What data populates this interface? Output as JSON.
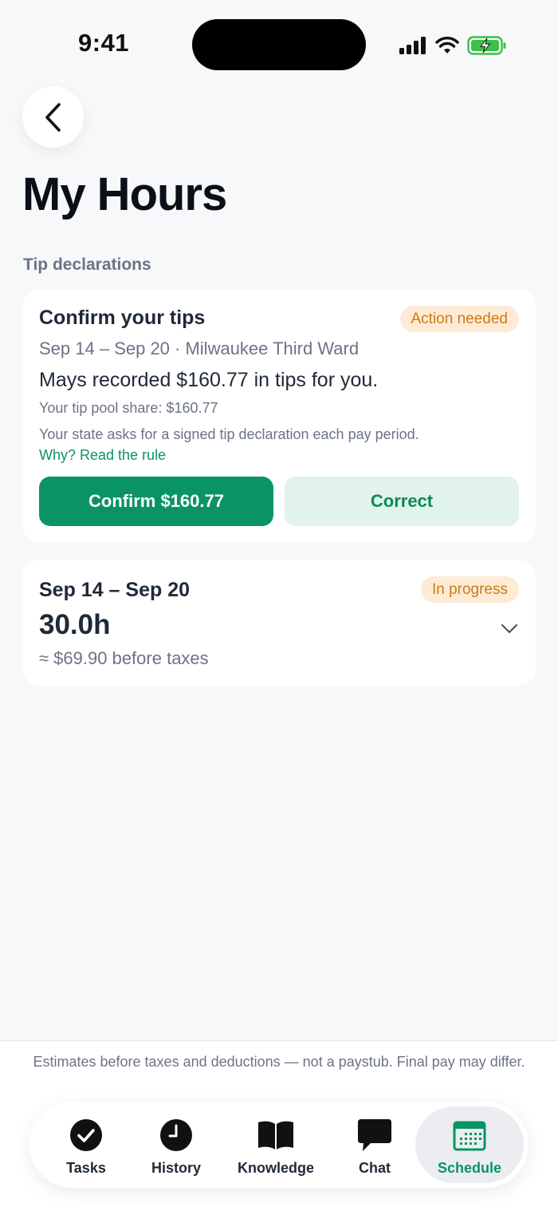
{
  "status_bar": {
    "time": "9:41"
  },
  "header": {
    "title": "My Hours"
  },
  "tips_section": {
    "label": "Tip declarations",
    "card": {
      "title": "Confirm your tips",
      "badge": "Action needed",
      "period_location": "Sep 14 – Sep 20 · Milwaukee Third Ward",
      "recorded_text": "Mays recorded $160.77 in tips for you.",
      "pool_share": "Your tip pool share: $160.77",
      "state_note": "Your state asks for a signed tip declaration each pay period.",
      "rule_link": "Why? Read the rule",
      "confirm_label": "Confirm $160.77",
      "correct_label": "Correct"
    }
  },
  "hours_card": {
    "period": "Sep 14 – Sep 20",
    "badge": "In progress",
    "hours": "30.0h",
    "estimate": "≈ $69.90 before taxes"
  },
  "footer": {
    "disclaimer": "Estimates before taxes and deductions — not a paystub. Final pay may differ."
  },
  "tabbar": {
    "items": [
      {
        "label": "Tasks",
        "icon": "check-circle-icon"
      },
      {
        "label": "History",
        "icon": "clock-icon"
      },
      {
        "label": "Knowledge",
        "icon": "book-icon"
      },
      {
        "label": "Chat",
        "icon": "chat-bubble-icon"
      },
      {
        "label": "Schedule",
        "icon": "calendar-icon"
      }
    ],
    "active": "Schedule"
  },
  "colors": {
    "accent": "#0a9464",
    "badge_bg": "#fdebd6",
    "badge_text": "#d07a12",
    "background": "#f7f8fa"
  }
}
